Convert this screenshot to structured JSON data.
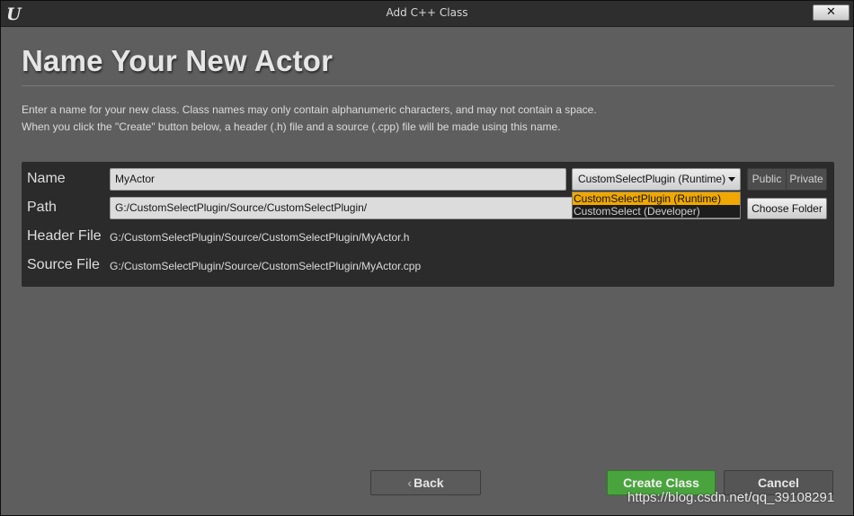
{
  "window": {
    "title": "Add C++ Class",
    "logo_text": "U",
    "close_label": "✕"
  },
  "heading": "Name Your New Actor",
  "description": {
    "line1": "Enter a name for your new class. Class names may only contain alphanumeric characters, and may not contain a space.",
    "line2": "When you click the \"Create\" button below, a header (.h) file and a source (.cpp) file will be made using this name."
  },
  "form": {
    "name_label": "Name",
    "name_value": "MyActor",
    "path_label": "Path",
    "path_value": "G:/CustomSelectPlugin/Source/CustomSelectPlugin/",
    "header_label": "Header File",
    "header_value": "G:/CustomSelectPlugin/Source/CustomSelectPlugin/MyActor.h",
    "source_label": "Source File",
    "source_value": "G:/CustomSelectPlugin/Source/CustomSelectPlugin/MyActor.cpp"
  },
  "module_select": {
    "selected": "CustomSelectPlugin (Runtime)",
    "options": [
      "CustomSelectPlugin (Runtime)",
      "CustomSelect (Developer)"
    ]
  },
  "visibility": {
    "public_label": "Public",
    "private_label": "Private"
  },
  "choose_folder_label": "Choose Folder",
  "footer": {
    "back_chevron": "‹",
    "back_label": "Back",
    "create_label": "Create Class",
    "cancel_label": "Cancel"
  },
  "watermark": "https://blog.csdn.net/qq_39108291",
  "colors": {
    "create_green": "#4aa43e",
    "selected_option": "#f0a800",
    "window_bg": "#5e5e5e",
    "panel_bg": "#2b2b2b"
  }
}
